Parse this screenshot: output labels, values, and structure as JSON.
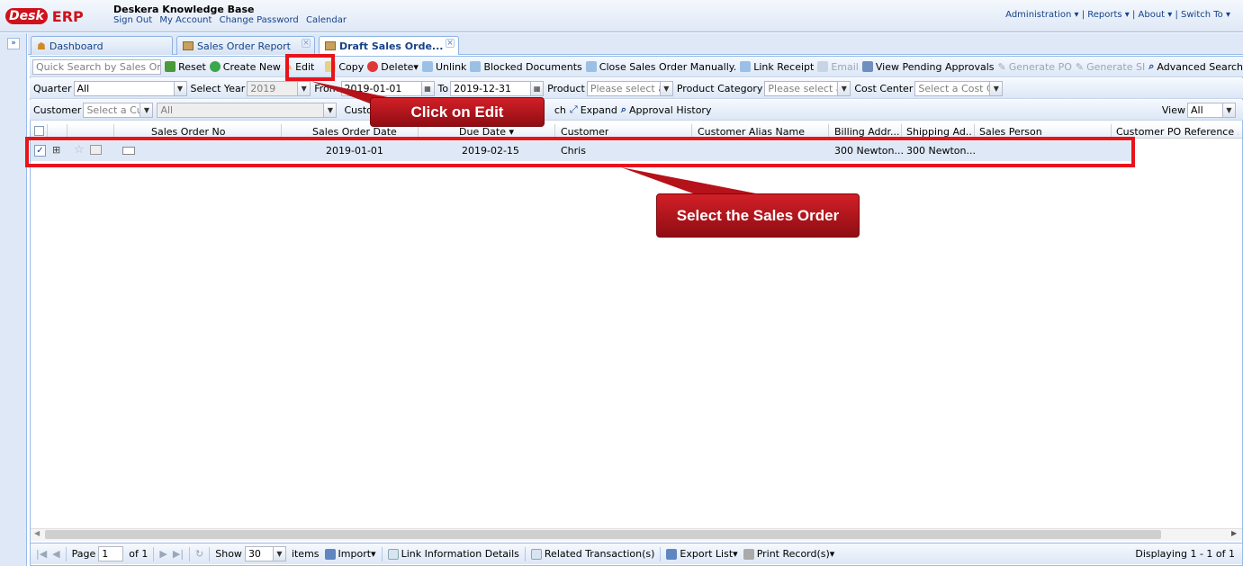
{
  "app": {
    "logo_text": "Desk",
    "logo_suffix": "ERP",
    "kb_title": "Deskera Knowledge Base",
    "top_links": [
      "Sign Out",
      "My Account",
      "Change Password",
      "Calendar"
    ],
    "right_menu": "Administration ▾ | Reports ▾ | About ▾ | Switch To ▾"
  },
  "tabs": [
    {
      "label": "Dashboard"
    },
    {
      "label": "Sales Order Report"
    },
    {
      "label": "Draft Sales Orde..."
    }
  ],
  "toolbar1": {
    "search_placeholder": "Quick Search by Sales Order",
    "reset": "Reset",
    "create_new": "Create New",
    "edit": "Edit",
    "copy": "Copy",
    "delete": "Delete▾",
    "unlink": "Unlink",
    "blocked_documents": "Blocked Documents",
    "close_manually": "Close Sales Order Manually.",
    "link_receipt": "Link Receipt",
    "email": "Email",
    "view_pending": "View Pending Approvals",
    "generate_po": "Generate PO",
    "generate_si": "Generate SI",
    "advanced_search": "Advanced Search"
  },
  "toolbar2": {
    "quarter_label": "Quarter",
    "quarter_value": "All",
    "year_label": "Select Year",
    "year_value": "2019",
    "from_label": "From",
    "from_value": "2019-01-01",
    "to_label": "To",
    "to_value": "2019-12-31",
    "product_label": "Product",
    "product_placeholder": "Please select a",
    "product_category_label": "Product Category",
    "product_category_placeholder": "Please select a",
    "cost_center_label": "Cost Center",
    "cost_center_placeholder": "Select a Cost C"
  },
  "toolbar3": {
    "customer_label": "Customer",
    "customer_placeholder": "Select a Cu",
    "second_value": "All",
    "custom_label": "Custo",
    "search_label": "ch",
    "expand": "Expand",
    "approval_history": "Approval History",
    "view_label": "View",
    "view_value": "All"
  },
  "grid": {
    "columns": [
      "Sales Order No",
      "Sales Order Date",
      "Due Date ▾",
      "Customer",
      "Customer Alias Name",
      "Billing Addr...",
      "Shipping Ad...",
      "Sales Person",
      "Customer PO Reference ..."
    ],
    "row": {
      "date": "2019-01-01",
      "due": "2019-02-15",
      "customer": "Chris",
      "billing": "300 Newton...",
      "shipping": "300 Newton..."
    }
  },
  "callouts": {
    "edit": "Click on Edit",
    "select": "Select the Sales Order"
  },
  "pager": {
    "page_label": "Page",
    "page_value": "1",
    "of": "of 1",
    "show": "Show",
    "show_value": "30",
    "items": "items",
    "import": "Import▾",
    "link_info": "Link Information Details",
    "related": "Related Transaction(s)",
    "export": "Export List▾",
    "print": "Print Record(s)▾",
    "displaying": "Displaying 1 - 1 of 1"
  }
}
